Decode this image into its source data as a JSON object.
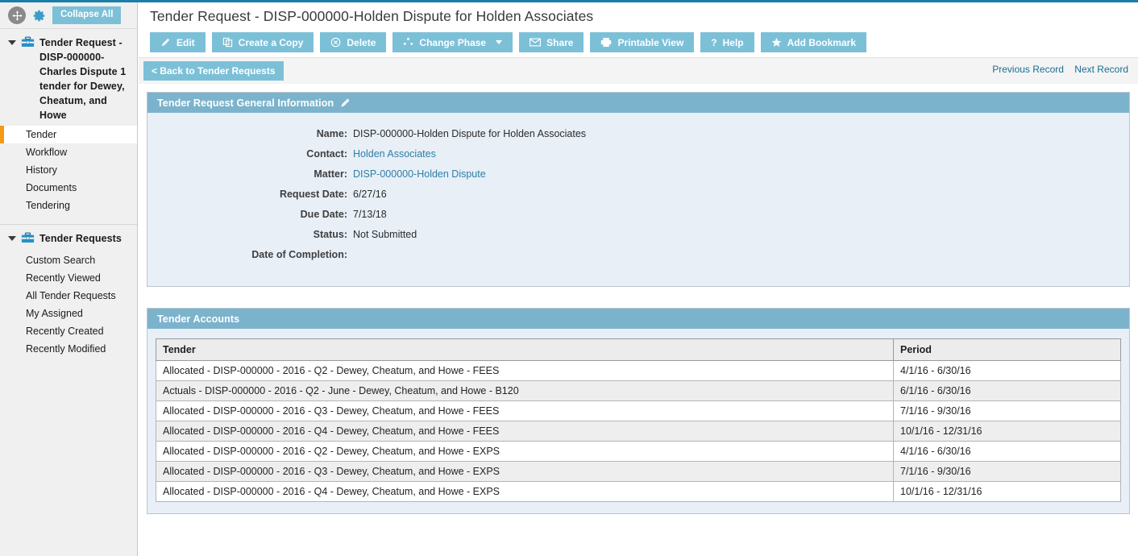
{
  "theme": {
    "accent_teal": "#7cc0d8",
    "panel_header": "#7cb3cc",
    "panel_body": "#e8eff7",
    "active_marker": "#f49a15",
    "link": "#2e7fa5",
    "top_rule": "#1b7ea6"
  },
  "sidebar": {
    "collapse_label": "Collapse All",
    "move_icon": "move-icon",
    "gear_icon": "gear-icon",
    "groups": [
      {
        "title": "Tender Request - DISP-000000-Charles Dispute 1 tender for Dewey, Cheatum, and Howe",
        "icon": "briefcase-icon",
        "items": [
          {
            "label": "Tender",
            "active": true
          },
          {
            "label": "Workflow",
            "active": false
          },
          {
            "label": "History",
            "active": false
          },
          {
            "label": "Documents",
            "active": false
          },
          {
            "label": "Tendering",
            "active": false
          }
        ]
      },
      {
        "title": "Tender Requests",
        "icon": "briefcase-icon",
        "items": [
          {
            "label": "Custom Search",
            "active": false
          },
          {
            "label": "Recently Viewed",
            "active": false
          },
          {
            "label": "All Tender Requests",
            "active": false
          },
          {
            "label": "My Assigned",
            "active": false
          },
          {
            "label": "Recently Created",
            "active": false
          },
          {
            "label": "Recently Modified",
            "active": false
          }
        ]
      }
    ]
  },
  "header": {
    "title": "Tender Request - DISP-000000-Holden Dispute for Holden Associates"
  },
  "toolbar": {
    "buttons": [
      {
        "label": "Edit",
        "icon": "pencil-icon",
        "dropdown": false
      },
      {
        "label": "Create a Copy",
        "icon": "copy-icon",
        "dropdown": false
      },
      {
        "label": "Delete",
        "icon": "delete-circle-x-icon",
        "dropdown": false
      },
      {
        "label": "Change Phase",
        "icon": "change-phase-icon",
        "dropdown": true
      },
      {
        "label": "Share",
        "icon": "envelope-icon",
        "dropdown": false
      },
      {
        "label": "Printable View",
        "icon": "printer-icon",
        "dropdown": false
      },
      {
        "label": "Help",
        "icon": "question-mark-icon",
        "dropdown": false
      },
      {
        "label": "Add Bookmark",
        "icon": "star-icon",
        "dropdown": false
      }
    ]
  },
  "subbar": {
    "back_label": "< Back to Tender Requests",
    "previous_record": "Previous Record",
    "next_record": "Next Record"
  },
  "general_info": {
    "panel_title": "Tender Request General Information",
    "edit_icon": "pencil-icon",
    "fields": [
      {
        "label": "Name:",
        "value": "DISP-000000-Holden Dispute for Holden Associates",
        "link": false
      },
      {
        "label": "Contact:",
        "value": "Holden Associates",
        "link": true
      },
      {
        "label": "Matter:",
        "value": "DISP-000000-Holden Dispute",
        "link": true
      },
      {
        "label": "Request Date:",
        "value": "6/27/16",
        "link": false
      },
      {
        "label": "Due Date:",
        "value": "7/13/18",
        "link": false
      },
      {
        "label": "Status:",
        "value": "Not Submitted",
        "link": false
      },
      {
        "label": "Date of Completion:",
        "value": "",
        "link": false
      }
    ]
  },
  "tender_accounts": {
    "panel_title": "Tender Accounts",
    "columns": [
      "Tender",
      "Period"
    ],
    "rows": [
      {
        "tender": "Allocated - DISP-000000 - 2016 - Q2 - Dewey, Cheatum, and Howe - FEES",
        "period": "4/1/16 - 6/30/16"
      },
      {
        "tender": "Actuals - DISP-000000 - 2016 - Q2 - June - Dewey, Cheatum, and Howe - B120",
        "period": "6/1/16 - 6/30/16"
      },
      {
        "tender": "Allocated - DISP-000000 - 2016 - Q3 - Dewey, Cheatum, and Howe - FEES",
        "period": "7/1/16 - 9/30/16"
      },
      {
        "tender": "Allocated - DISP-000000 - 2016 - Q4 - Dewey, Cheatum, and Howe - FEES",
        "period": "10/1/16 - 12/31/16"
      },
      {
        "tender": "Allocated - DISP-000000 - 2016 - Q2 - Dewey, Cheatum, and Howe - EXPS",
        "period": "4/1/16 - 6/30/16"
      },
      {
        "tender": "Allocated - DISP-000000 - 2016 - Q3 - Dewey, Cheatum, and Howe - EXPS",
        "period": "7/1/16 - 9/30/16"
      },
      {
        "tender": "Allocated - DISP-000000 - 2016 - Q4 - Dewey, Cheatum, and Howe - EXPS",
        "period": "10/1/16 - 12/31/16"
      }
    ]
  }
}
